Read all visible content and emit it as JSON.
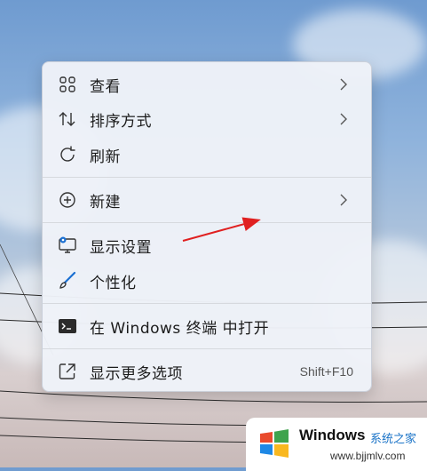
{
  "context_menu": {
    "items": [
      {
        "label": "查看",
        "icon": "grid-view-icon",
        "submenu": true
      },
      {
        "label": "排序方式",
        "icon": "sort-icon",
        "submenu": true
      },
      {
        "label": "刷新",
        "icon": "refresh-icon",
        "submenu": false
      },
      {
        "label": "新建",
        "icon": "new-plus-icon",
        "submenu": true
      },
      {
        "label": "显示设置",
        "icon": "display-settings-icon",
        "submenu": false
      },
      {
        "label": "个性化",
        "icon": "brush-icon",
        "submenu": false
      },
      {
        "label": "在 Windows 终端 中打开",
        "icon": "terminal-icon",
        "submenu": false
      },
      {
        "label": "显示更多选项",
        "icon": "more-options-icon",
        "submenu": false,
        "shortcut": "Shift+F10"
      }
    ]
  },
  "watermark": {
    "title": "Windows",
    "subtitle": "系统之家",
    "url": "www.bjjmlv.com"
  },
  "colors": {
    "annotation_arrow": "#e02020",
    "accent": "#0f6cbd"
  }
}
